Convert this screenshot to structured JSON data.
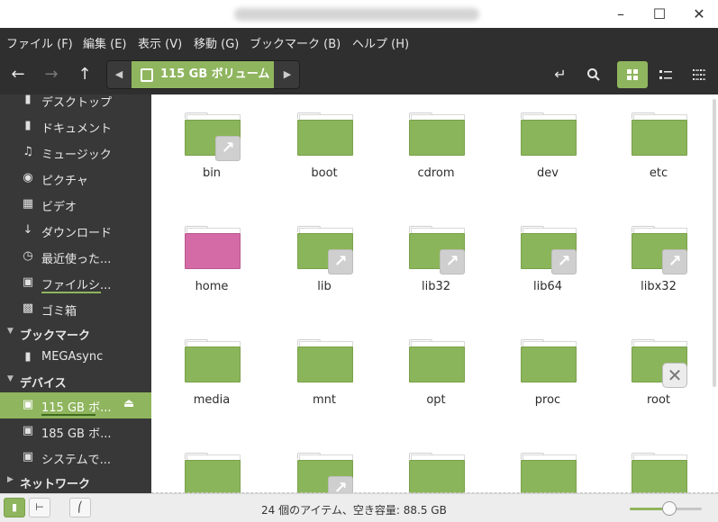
{
  "window": {
    "title": ""
  },
  "menu": [
    "ファイル (F)",
    "編集 (E)",
    "表示 (V)",
    "移動 (G)",
    "ブックマーク (B)",
    "ヘルプ (H)"
  ],
  "path": {
    "current": "115 GB ボリューム"
  },
  "sidebar": {
    "items_top": [
      {
        "label": "デスクトップ",
        "icon": "folder-icon"
      },
      {
        "label": "ドキュメント",
        "icon": "document-icon"
      },
      {
        "label": "ミュージック",
        "icon": "music-icon"
      },
      {
        "label": "ピクチャ",
        "icon": "camera-icon"
      },
      {
        "label": "ビデオ",
        "icon": "film-icon"
      },
      {
        "label": "ダウンロード",
        "icon": "download-icon"
      },
      {
        "label": "最近使った...",
        "icon": "history-icon"
      },
      {
        "label": "ファイルシ...",
        "icon": "drive-icon"
      },
      {
        "label": "ゴミ箱",
        "icon": "trash-icon"
      }
    ],
    "bookmarks_header": "ブックマーク",
    "bookmarks": [
      {
        "label": "MEGAsync",
        "icon": "folder-icon"
      }
    ],
    "devices_header": "デバイス",
    "devices": [
      {
        "label": "115 GB ボ...",
        "icon": "drive-icon",
        "active": true
      },
      {
        "label": "185 GB ボ...",
        "icon": "drive-icon"
      },
      {
        "label": "システムで...",
        "icon": "drive-icon"
      }
    ],
    "network_header": "ネットワーク"
  },
  "files": [
    {
      "name": "bin",
      "badge": "link"
    },
    {
      "name": "boot"
    },
    {
      "name": "cdrom"
    },
    {
      "name": "dev"
    },
    {
      "name": "etc"
    },
    {
      "name": "home",
      "color": "pink"
    },
    {
      "name": "lib",
      "badge": "link"
    },
    {
      "name": "lib32",
      "badge": "link"
    },
    {
      "name": "lib64",
      "badge": "link"
    },
    {
      "name": "libx32",
      "badge": "link"
    },
    {
      "name": "media"
    },
    {
      "name": "mnt"
    },
    {
      "name": "opt"
    },
    {
      "name": "proc"
    },
    {
      "name": "root",
      "badge": "locked"
    },
    {
      "name": ""
    },
    {
      "name": "",
      "badge": "link"
    },
    {
      "name": ""
    },
    {
      "name": ""
    },
    {
      "name": ""
    }
  ],
  "status": {
    "text": "24 個のアイテム、空き容量: 88.5 GB",
    "zoom_level": 0.55
  },
  "colors": {
    "accent": "#8fb55e",
    "folder": "#8bb55a",
    "home_folder": "#d46aa6",
    "dark_bg": "#2f2f2f",
    "sidebar_bg": "#383838"
  }
}
